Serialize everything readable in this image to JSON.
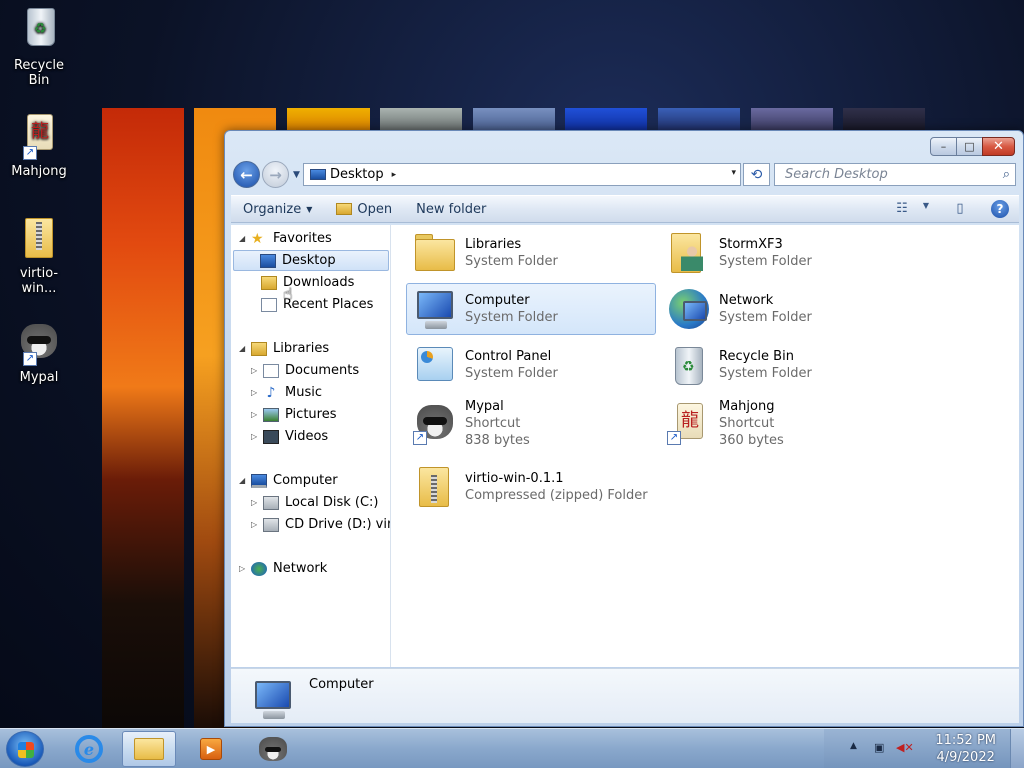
{
  "desktop": {
    "icons": [
      {
        "label": "Recycle\nBin",
        "icon": "recycle-bin-icon"
      },
      {
        "label": "Mahjong",
        "icon": "mahjong-icon"
      },
      {
        "label": "virtio-win...",
        "icon": "zip-folder-icon"
      },
      {
        "label": "Mypal",
        "icon": "mypal-icon"
      }
    ]
  },
  "window": {
    "caption": {
      "minimize": "–",
      "maximize": "□",
      "close": "✕"
    },
    "address": {
      "location": "Desktop",
      "separator": "▸",
      "dropdown": "▾"
    },
    "search": {
      "placeholder": "Search Desktop"
    },
    "toolbar": {
      "organize": "Organize",
      "open": "Open",
      "new_folder": "New folder"
    },
    "nav_pane": {
      "favorites": "Favorites",
      "desktop": "Desktop",
      "downloads": "Downloads",
      "recent_places": "Recent Places",
      "libraries": "Libraries",
      "documents": "Documents",
      "music": "Music",
      "pictures": "Pictures",
      "videos": "Videos",
      "computer": "Computer",
      "local_disk": "Local Disk (C:)",
      "cd_drive": "CD Drive (D:) vir",
      "network": "Network"
    },
    "items": [
      {
        "name": "Libraries",
        "line1": "System Folder",
        "line2": ""
      },
      {
        "name": "StormXF3",
        "line1": "System Folder",
        "line2": ""
      },
      {
        "name": "Computer",
        "line1": "System Folder",
        "line2": ""
      },
      {
        "name": "Network",
        "line1": "System Folder",
        "line2": ""
      },
      {
        "name": "Control Panel",
        "line1": "System Folder",
        "line2": ""
      },
      {
        "name": "Recycle Bin",
        "line1": "System Folder",
        "line2": ""
      },
      {
        "name": "Mypal",
        "line1": "Shortcut",
        "line2": "838 bytes"
      },
      {
        "name": "Mahjong",
        "line1": "Shortcut",
        "line2": "360 bytes"
      },
      {
        "name": "virtio-win-0.1.1",
        "line1": "Compressed (zipped) Folder",
        "line2": ""
      }
    ],
    "selected_item": "Computer",
    "details": {
      "name": "Computer"
    }
  },
  "taskbar": {
    "clock": {
      "time": "11:52 PM",
      "date": "4/9/2022"
    },
    "tray": {
      "show_hidden": "▲"
    }
  },
  "colors": {
    "accent": "#1a4ea8",
    "selection": "#d4e6fa",
    "taskbar": "#8aa8cc"
  }
}
